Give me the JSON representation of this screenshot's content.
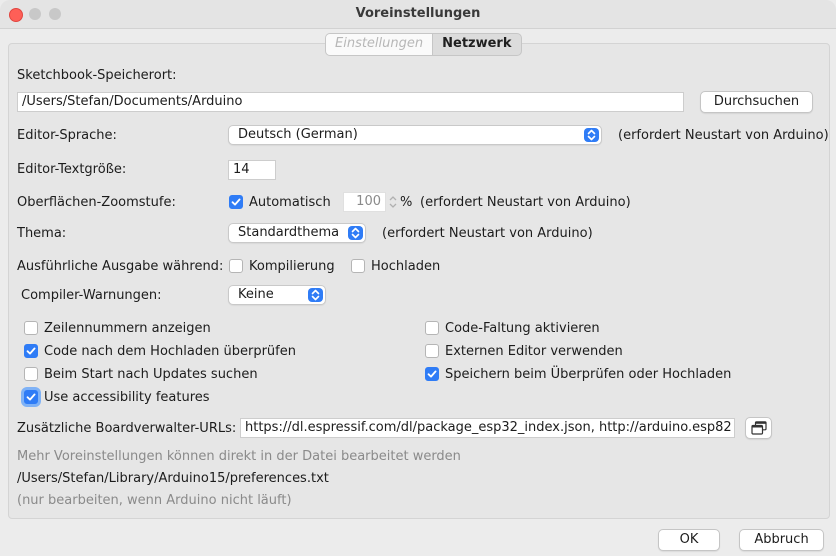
{
  "window": {
    "title": "Voreinstellungen"
  },
  "tabs": [
    {
      "label": "Einstellungen",
      "active": true
    },
    {
      "label": "Netzwerk",
      "active": false
    }
  ],
  "sketchbook": {
    "label": "Sketchbook-Speicherort:",
    "path": "/Users/Stefan/Documents/Arduino",
    "browse_label": "Durchsuchen"
  },
  "editor_language": {
    "label": "Editor-Sprache:",
    "value": "Deutsch (German)",
    "note": "(erfordert Neustart von Arduino)"
  },
  "editor_font_size": {
    "label": "Editor-Textgröße:",
    "value": "14"
  },
  "zoom": {
    "label": "Oberflächen-Zoomstufe:",
    "auto_label": "Automatisch",
    "auto_checked": true,
    "value": "100",
    "unit": "%",
    "note": "(erfordert Neustart von Arduino)"
  },
  "theme": {
    "label": "Thema:",
    "value": "Standardthema",
    "note": "(erfordert Neustart von Arduino)"
  },
  "verbose": {
    "label": "Ausführliche Ausgabe während:",
    "compile_label": "Kompilierung",
    "compile_checked": false,
    "upload_label": "Hochladen",
    "upload_checked": false
  },
  "compiler_warnings": {
    "label": "Compiler-Warnungen:",
    "value": "Keine"
  },
  "options_left": [
    {
      "label": "Zeilennummern anzeigen",
      "checked": false
    },
    {
      "label": "Code nach dem Hochladen überprüfen",
      "checked": true
    },
    {
      "label": "Beim Start nach Updates suchen",
      "checked": false
    },
    {
      "label": "Use accessibility features",
      "checked": true
    }
  ],
  "options_right": [
    {
      "label": "Code-Faltung aktivieren",
      "checked": false
    },
    {
      "label": "Externen Editor verwenden",
      "checked": false
    },
    {
      "label": "Speichern beim Überprüfen oder Hochladen",
      "checked": true
    }
  ],
  "board_urls": {
    "label": "Zusätzliche Boardverwalter-URLs:",
    "value": "https://dl.espressif.com/dl/package_esp32_index.json, http://arduino.esp82"
  },
  "footer_info": {
    "more_text": "Mehr Voreinstellungen können direkt in der Datei bearbeitet werden",
    "file_path": "/Users/Stefan/Library/Arduino15/preferences.txt",
    "edit_note": "(nur bearbeiten, wenn Arduino nicht läuft)"
  },
  "buttons": {
    "ok": "OK",
    "cancel": "Abbruch"
  },
  "colors": {
    "accent": "#2f7cf6",
    "close_light": "#fe5f57"
  },
  "icons": [
    "select-arrows-icon",
    "checkmark-icon",
    "window-copy-icon",
    "stepper-icon"
  ]
}
